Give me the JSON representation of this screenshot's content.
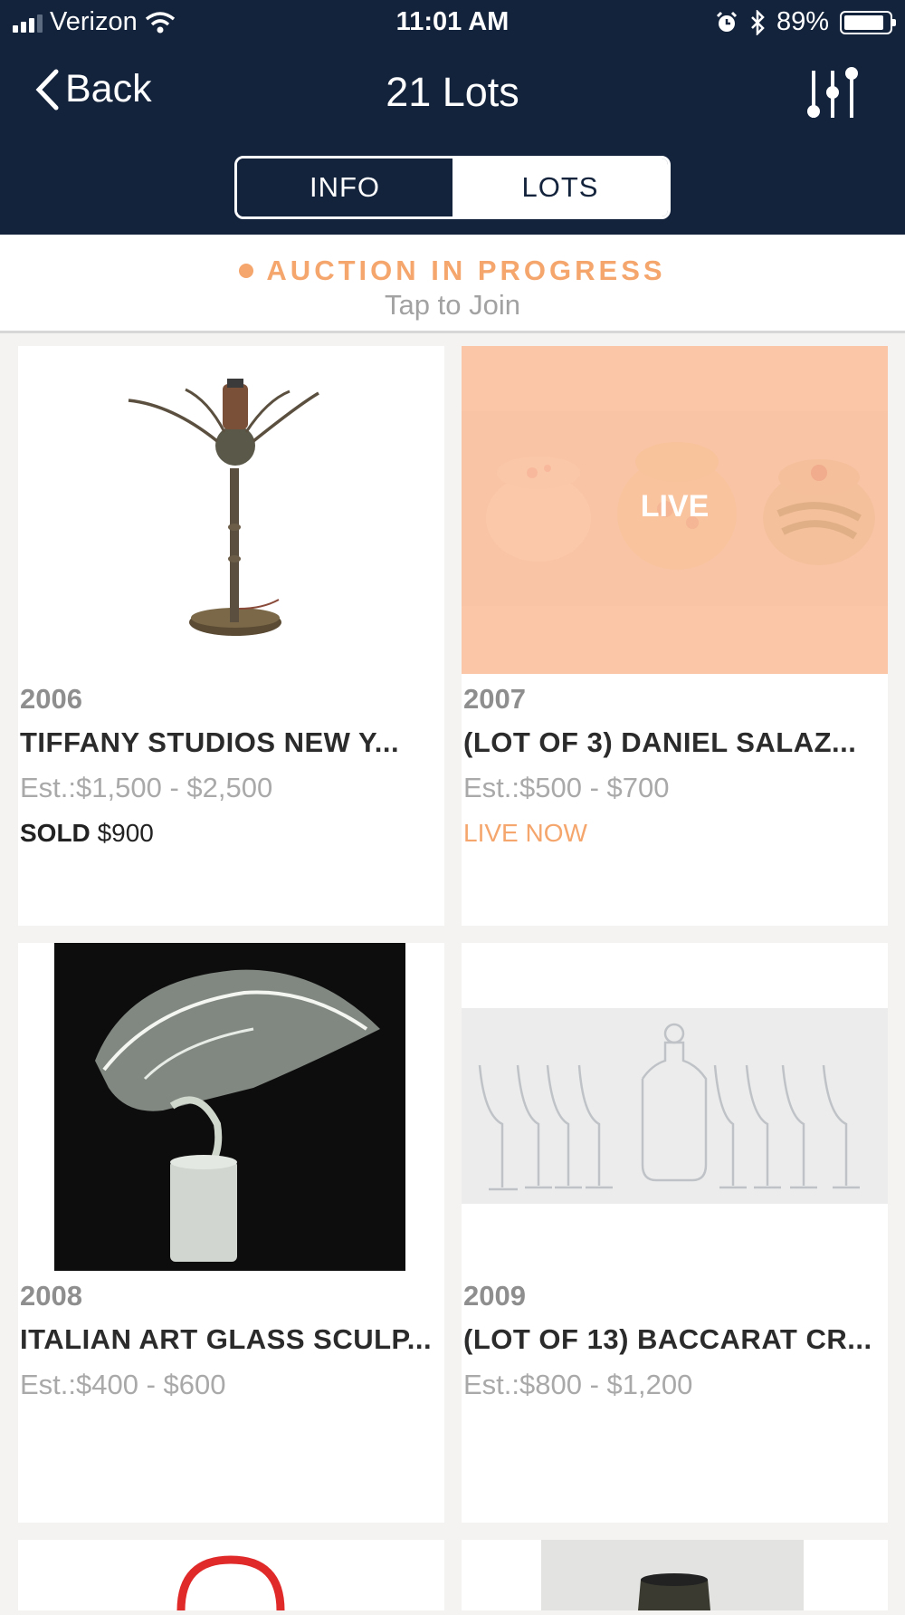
{
  "status_bar": {
    "carrier": "Verizon",
    "time": "11:01 AM",
    "battery": "89%",
    "battery_level": 0.89
  },
  "nav": {
    "back_label": "Back",
    "title": "21 Lots"
  },
  "segments": [
    {
      "label": "INFO",
      "selected": false
    },
    {
      "label": "LOTS",
      "selected": true
    }
  ],
  "banner": {
    "status": "AUCTION IN PROGRESS",
    "action": "Tap to Join"
  },
  "lots": [
    {
      "number": "2006",
      "title": "TIFFANY STUDIOS NEW Y...",
      "estimate": "Est.:$1,500 - $2,500",
      "result_label": "SOLD",
      "result_value": "$900"
    },
    {
      "number": "2007",
      "title": "(LOT OF 3) DANIEL SALAZ...",
      "estimate": "Est.:$500 - $700",
      "overlay": "LIVE",
      "live_label": "LIVE NOW"
    },
    {
      "number": "2008",
      "title": "ITALIAN ART GLASS SCULP...",
      "estimate": "Est.:$400 - $600"
    },
    {
      "number": "2009",
      "title": "(LOT OF 13) BACCARAT CR...",
      "estimate": "Est.:$800 - $1,200"
    }
  ],
  "colors": {
    "header_bg": "#14233c",
    "accent": "#f5a66d",
    "page_bg": "#f4f3f1"
  }
}
